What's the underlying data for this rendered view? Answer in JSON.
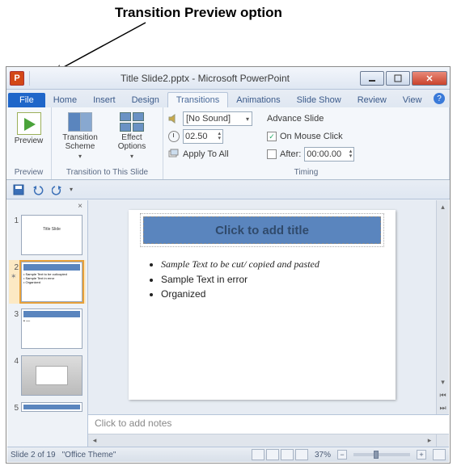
{
  "annotation": "Transition Preview option",
  "window": {
    "title": "Title Slide2.pptx - Microsoft PowerPoint",
    "app_letter": "P"
  },
  "tabs": {
    "file": "File",
    "home": "Home",
    "insert": "Insert",
    "design": "Design",
    "transitions": "Transitions",
    "animations": "Animations",
    "slideshow": "Slide Show",
    "review": "Review",
    "view": "View"
  },
  "ribbon": {
    "preview": {
      "label": "Preview",
      "group": "Preview"
    },
    "transition_scheme": "Transition\nScheme",
    "effect_options": "Effect\nOptions",
    "group_transition": "Transition to This Slide",
    "sound_value": "[No Sound]",
    "duration_value": "02.50",
    "apply_all": "Apply To All",
    "advance_label": "Advance Slide",
    "on_mouse": "On Mouse Click",
    "after_label": "After:",
    "after_value": "00:00.00",
    "group_timing": "Timing"
  },
  "thumbs": {
    "n1": "1",
    "n2": "2",
    "n3": "3",
    "n4": "4",
    "n5": "5"
  },
  "slide": {
    "title_placeholder": "Click to add title",
    "bullet1": "Sample Text to be cut/ copied and pasted",
    "bullet2": "Sample Text in error",
    "bullet3": "Organized"
  },
  "notes_placeholder": "Click to add notes",
  "status": {
    "slide": "Slide 2 of 19",
    "theme": "\"Office Theme\"",
    "zoom": "37%"
  }
}
